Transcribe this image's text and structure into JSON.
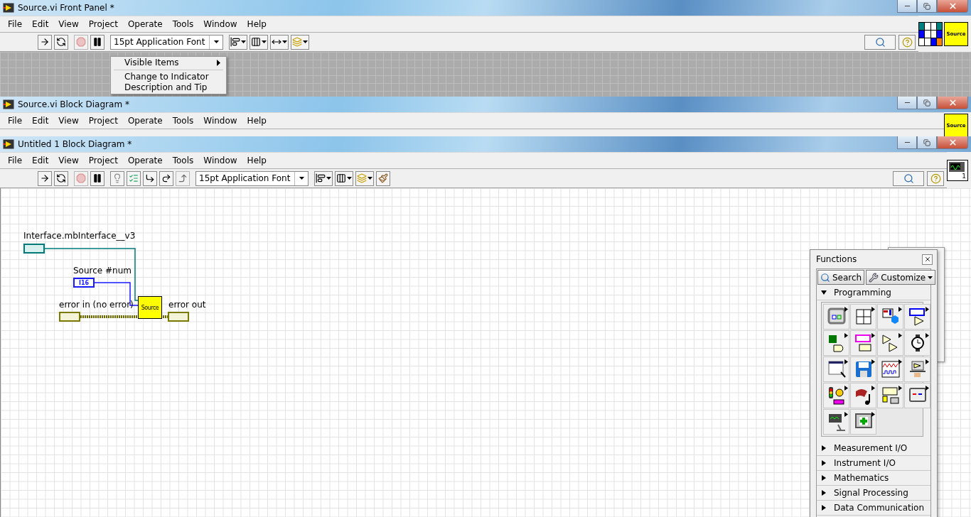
{
  "windows": [
    {
      "kind": "front_panel",
      "title": "Source.vi Front Panel *",
      "menu": [
        "File",
        "Edit",
        "View",
        "Project",
        "Operate",
        "Tools",
        "Window",
        "Help"
      ],
      "icon_label": "Source",
      "toolbar": {
        "font": "15pt Application Font",
        "buttons": [
          {
            "kind": "run",
            "disabled": false
          },
          {
            "kind": "run_continuous",
            "disabled": false
          },
          {
            "kind": "abort",
            "disabled": true
          },
          {
            "kind": "pause",
            "disabled": false
          },
          {
            "kind": "font"
          },
          {
            "kind": "align",
            "disabled": false
          },
          {
            "kind": "distribute",
            "disabled": false
          },
          {
            "kind": "resize",
            "disabled": false
          },
          {
            "kind": "reorder",
            "disabled": false
          }
        ]
      },
      "context_menu": [
        {
          "kind": "item",
          "label": "Visible Items",
          "submenu": true
        },
        {
          "kind": "separator"
        },
        {
          "kind": "item",
          "label": "Change to Indicator",
          "submenu": false
        },
        {
          "kind": "item",
          "label": "Description and Tip",
          "submenu": false
        }
      ]
    },
    {
      "kind": "covered",
      "title": "Source.vi Block Diagram *",
      "menu": [
        "File",
        "Edit",
        "View",
        "Project",
        "Operate",
        "Tools",
        "Window",
        "Help"
      ],
      "icon_label": "Source"
    },
    {
      "kind": "block_diagram",
      "title": "Untitled 1 Block Diagram *",
      "menu": [
        "File",
        "Edit",
        "View",
        "Project",
        "Operate",
        "Tools",
        "Window",
        "Help"
      ],
      "icon_label": "1",
      "toolbar": {
        "font": "15pt Application Font",
        "buttons": [
          {
            "kind": "run",
            "disabled": false
          },
          {
            "kind": "run_continuous",
            "disabled": false
          },
          {
            "kind": "abort",
            "disabled": true
          },
          {
            "kind": "pause",
            "disabled": false
          },
          {
            "kind": "highlight",
            "disabled": false
          },
          {
            "kind": "retain",
            "disabled": false
          },
          {
            "kind": "step_into",
            "disabled": false
          },
          {
            "kind": "step_over",
            "disabled": false
          },
          {
            "kind": "step_out",
            "disabled": true
          },
          {
            "kind": "font"
          },
          {
            "kind": "align",
            "disabled": false
          },
          {
            "kind": "distribute",
            "disabled": false
          },
          {
            "kind": "reorder",
            "disabled": false
          },
          {
            "kind": "cleanup",
            "disabled": false
          }
        ]
      },
      "diagram": {
        "terminals": [
          {
            "kind": "class",
            "label": "Interface.mbInterface__v3"
          },
          {
            "kind": "numeric",
            "label": "Source #num",
            "text": "I16"
          },
          {
            "kind": "error_in",
            "label": "error in (no error)"
          },
          {
            "kind": "error_out",
            "label": "error out"
          }
        ],
        "subvi": {
          "label": "Source"
        }
      },
      "palette": {
        "title": "Functions",
        "buttons": [
          "Search",
          "Customize"
        ],
        "sections": [
          {
            "label": "Programming",
            "expanded": true
          },
          {
            "label": "Measurement I/O",
            "expanded": false
          },
          {
            "label": "Instrument I/O",
            "expanded": false
          },
          {
            "label": "Mathematics",
            "expanded": false
          },
          {
            "label": "Signal Processing",
            "expanded": false
          },
          {
            "label": "Data Communication",
            "expanded": false
          }
        ]
      }
    }
  ]
}
